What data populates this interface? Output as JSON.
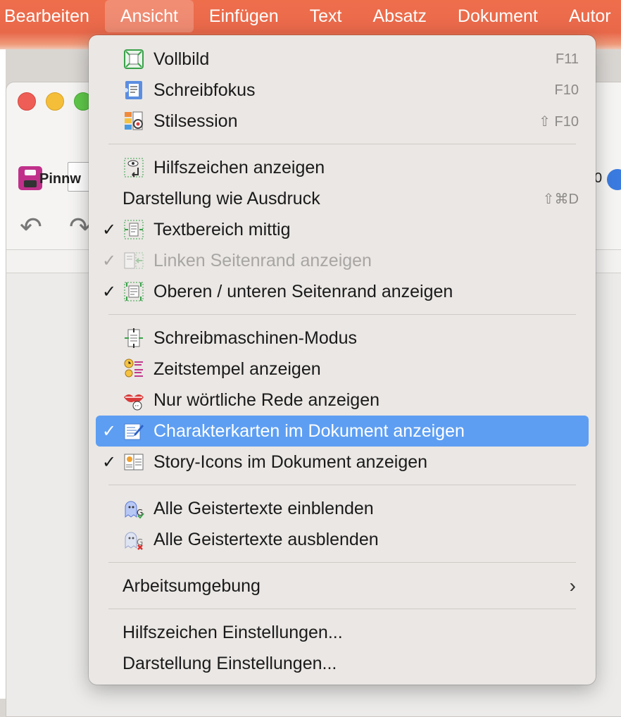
{
  "menubar": {
    "items": [
      "Bearbeiten",
      "Ansicht",
      "Einfügen",
      "Text",
      "Absatz",
      "Dokument",
      "Autor"
    ]
  },
  "background_window": {
    "tab_label": "Pinnw",
    "right_label": "0"
  },
  "menu": {
    "groups": [
      [
        {
          "label": "Vollbild",
          "icon": "fullscreen-icon",
          "shortcut": "F11",
          "checked": false,
          "disabled": false
        },
        {
          "label": "Schreibfokus",
          "icon": "writing-focus-icon",
          "shortcut": "F10",
          "checked": false,
          "disabled": false
        },
        {
          "label": "Stilsession",
          "icon": "style-session-icon",
          "shortcut": "⇧ F10",
          "checked": false,
          "disabled": false
        }
      ],
      [
        {
          "label": "Hilfszeichen anzeigen",
          "icon": "invisibles-icon",
          "shortcut": "",
          "checked": false,
          "disabled": false
        },
        {
          "label": "Darstellung wie Ausdruck",
          "icon": "",
          "shortcut": "⇧⌘D",
          "checked": false,
          "disabled": false
        },
        {
          "label": "Textbereich mittig",
          "icon": "text-center-icon",
          "shortcut": "",
          "checked": true,
          "disabled": false
        },
        {
          "label": "Linken Seitenrand anzeigen",
          "icon": "left-margin-icon",
          "shortcut": "",
          "checked": true,
          "disabled": true
        },
        {
          "label": "Oberen / unteren Seitenrand anzeigen",
          "icon": "top-bottom-margin-icon",
          "shortcut": "",
          "checked": true,
          "disabled": false
        }
      ],
      [
        {
          "label": "Schreibmaschinen-Modus",
          "icon": "typewriter-icon",
          "shortcut": "",
          "checked": false,
          "disabled": false
        },
        {
          "label": "Zeitstempel anzeigen",
          "icon": "timestamp-icon",
          "shortcut": "",
          "checked": false,
          "disabled": false
        },
        {
          "label": "Nur wörtliche Rede anzeigen",
          "icon": "speech-lips-icon",
          "shortcut": "",
          "checked": false,
          "disabled": false
        },
        {
          "label": "Charakterkarten im Dokument anzeigen",
          "icon": "character-card-icon",
          "shortcut": "",
          "checked": true,
          "disabled": false,
          "highlighted": true
        },
        {
          "label": "Story-Icons im Dokument anzeigen",
          "icon": "story-icon",
          "shortcut": "",
          "checked": true,
          "disabled": false
        }
      ],
      [
        {
          "label": "Alle Geistertexte einblenden",
          "icon": "ghost-show-icon",
          "shortcut": "",
          "checked": false,
          "disabled": false
        },
        {
          "label": "Alle Geistertexte ausblenden",
          "icon": "ghost-hide-icon",
          "shortcut": "",
          "checked": false,
          "disabled": false
        }
      ],
      [
        {
          "label": "Arbeitsumgebung",
          "icon": "",
          "shortcut": "",
          "checked": false,
          "disabled": false,
          "submenu": true
        }
      ],
      [
        {
          "label": "Hilfszeichen Einstellungen...",
          "icon": "",
          "shortcut": "",
          "checked": false,
          "disabled": false
        },
        {
          "label": "Darstellung Einstellungen...",
          "icon": "",
          "shortcut": "",
          "checked": false,
          "disabled": false
        }
      ]
    ]
  },
  "colors": {
    "menubar": "#e8684a",
    "highlight": "#5d9ef2",
    "menu_bg": "#eae7e4"
  }
}
